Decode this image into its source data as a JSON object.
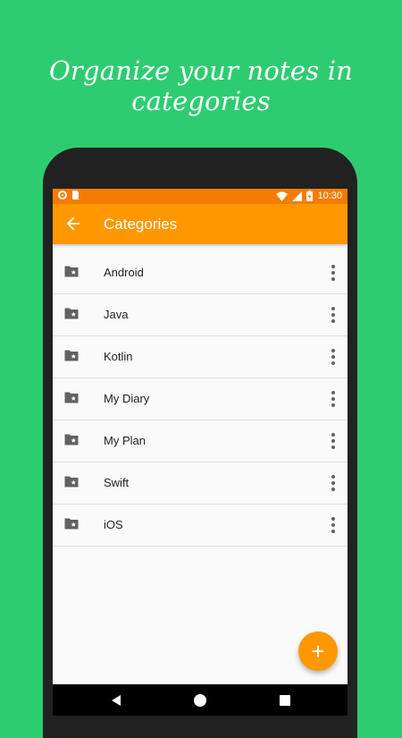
{
  "headline": "Organize your notes in categories",
  "statusbar": {
    "time": "10:30"
  },
  "appbar": {
    "title": "Categories",
    "back_icon": "arrow-back-icon"
  },
  "categories": [
    {
      "label": "Android"
    },
    {
      "label": "Java"
    },
    {
      "label": "Kotlin"
    },
    {
      "label": "My Diary"
    },
    {
      "label": "My Plan"
    },
    {
      "label": "Swift"
    },
    {
      "label": "iOS"
    }
  ],
  "fab": {
    "label": "+"
  },
  "colors": {
    "background": "#2ECC71",
    "statusbar": "#F57C00",
    "appbar": "#FF9800",
    "accent": "#FF9800"
  }
}
